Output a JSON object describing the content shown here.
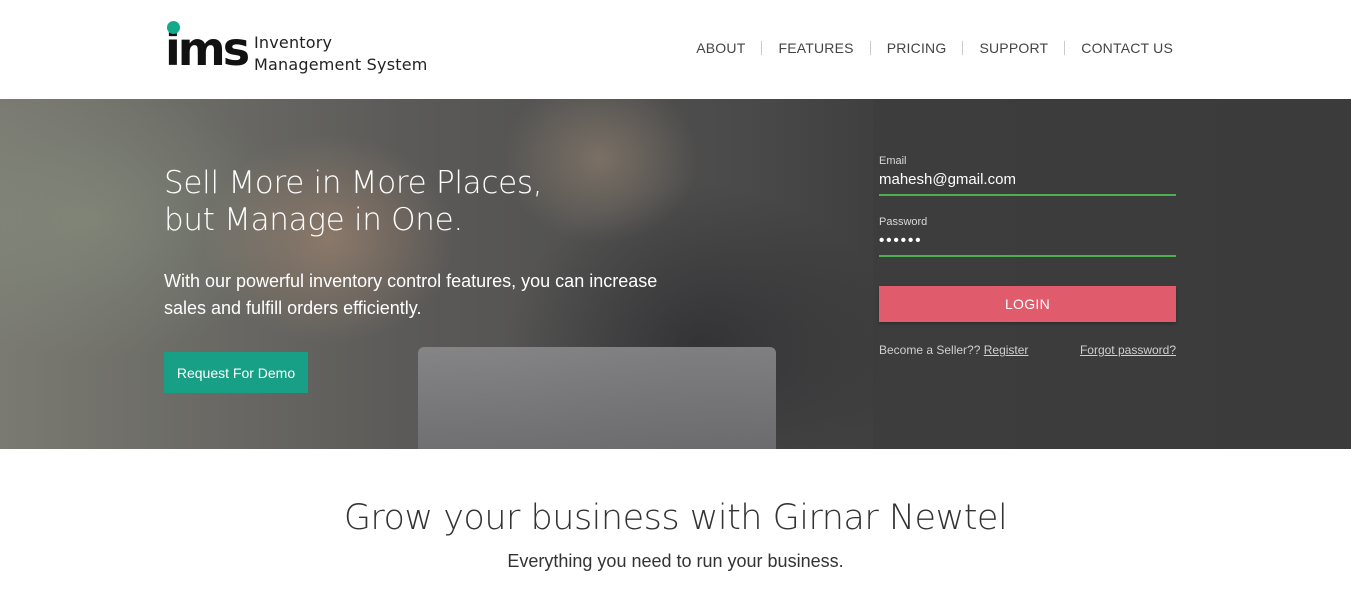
{
  "brand": {
    "logo_letters": "ims",
    "name_line1": "Inventory",
    "name_line2": "Management System",
    "accent_color": "#13a98a"
  },
  "nav": {
    "items": [
      {
        "label": "ABOUT"
      },
      {
        "label": "FEATURES"
      },
      {
        "label": "PRICING"
      },
      {
        "label": "SUPPORT"
      },
      {
        "label": "CONTACT US"
      }
    ]
  },
  "hero": {
    "title_line1": "Sell More in More Places,",
    "title_line2": "but Manage in One.",
    "subtitle": "With our powerful inventory control features, you can increase sales and fulfill orders efficiently.",
    "demo_button": "Request For Demo",
    "demo_button_color": "#17a085"
  },
  "login": {
    "email_label": "Email",
    "email_value": "mahesh@gmail.com",
    "password_label": "Password",
    "password_value": "••••••",
    "login_button": "LOGIN",
    "login_button_color": "#e05c6d",
    "become_seller_text": "Become a Seller??",
    "register_link": "Register",
    "forgot_link": "Forgot password?"
  },
  "section": {
    "title": "Grow your business with Girnar Newtel",
    "subtitle": "Everything you need to run your business."
  }
}
